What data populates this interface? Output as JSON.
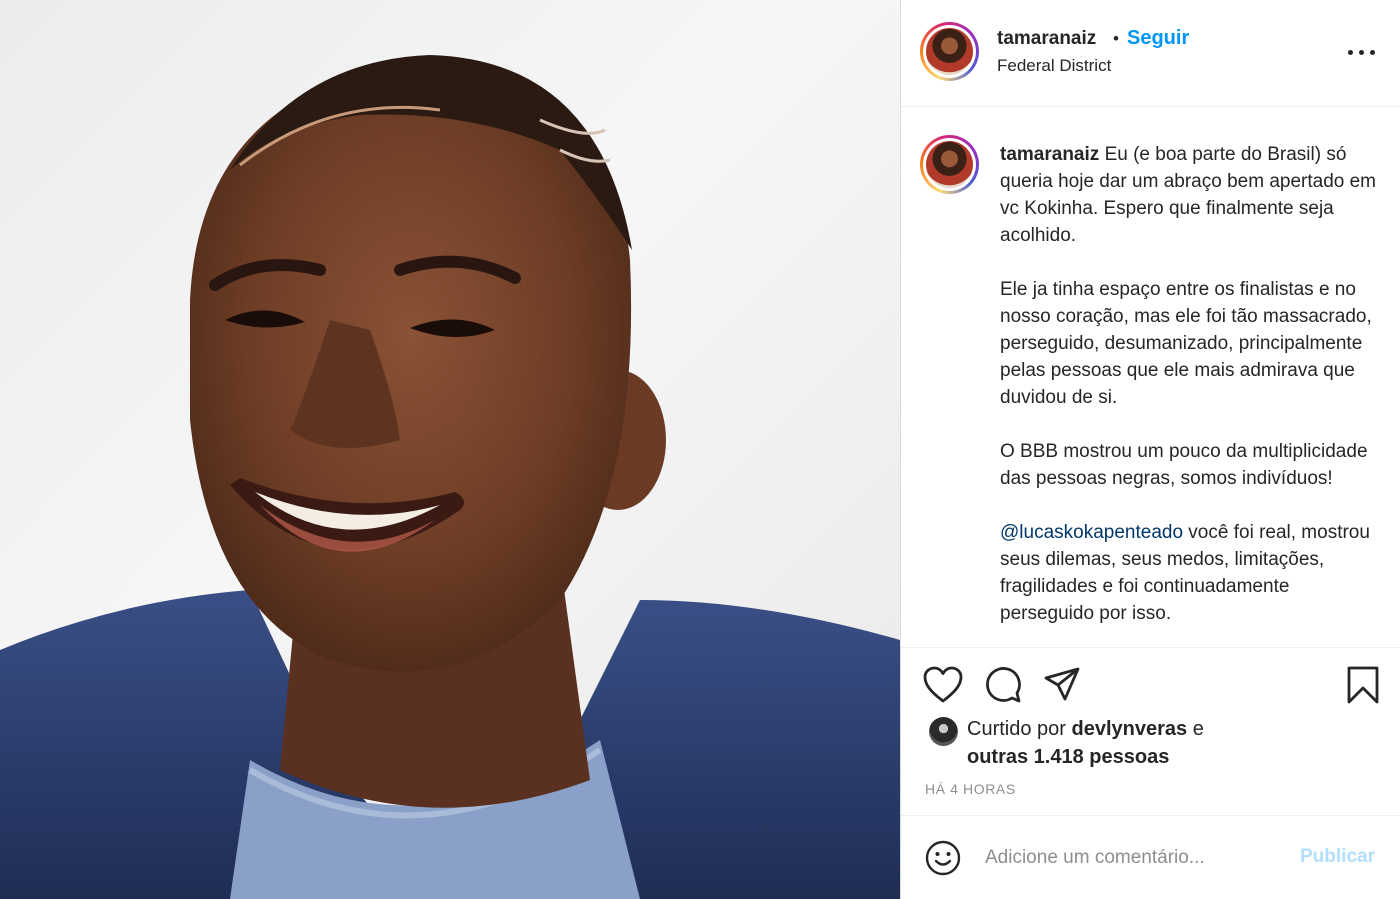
{
  "post": {
    "image_alt": "Retrato sorridente",
    "author": {
      "username": "tamaranaiz",
      "location": "Federal District",
      "follow_label": "Seguir",
      "separator": "•"
    },
    "caption": {
      "username": "tamaranaiz",
      "paragraph_1": "Eu (e boa parte do Brasil) só queria hoje dar um abraço bem apertado em vc Kokinha. Espero que finalmente seja acolhido.",
      "paragraph_2": "Ele ja tinha espaço entre os finalistas e no nosso coração, mas ele foi tão massacrado, perseguido, desumanizado, principalmente pelas pessoas que ele mais admirava que duvidou de si.",
      "paragraph_3": "O BBB mostrou um pouco da multiplicidade das pessoas negras, somos indivíduos!",
      "mention": "@lucaskokapenteado",
      "paragraph_4": " você foi real, mostrou seus dilemas, seus medos, limitações, fragilidades e foi continuadamente perseguido por isso."
    },
    "actions": {
      "like_icon": "heart-icon",
      "comment_icon": "comment-icon",
      "share_icon": "paper-plane-icon",
      "save_icon": "bookmark-icon"
    },
    "likes": {
      "prefix": "Curtido por ",
      "liked_by": "devlynveras",
      "conjunction": " e",
      "others": "outras 1.418 pessoas"
    },
    "timestamp": "HÁ 4 HORAS",
    "comment_box": {
      "emoji_icon": "smiley-icon",
      "placeholder": "Adicione um comentário...",
      "publish_label": "Publicar"
    },
    "colors": {
      "accent": "#0095f6",
      "publish_disabled": "#b2dffc",
      "mention": "#00376b",
      "muted": "#8e8e8e"
    }
  }
}
